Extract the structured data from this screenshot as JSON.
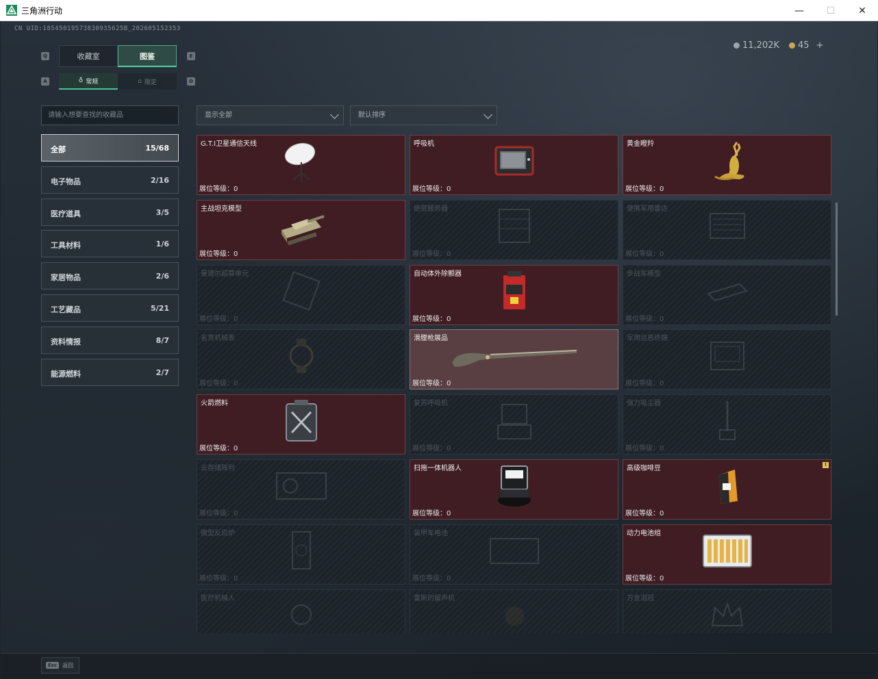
{
  "window": {
    "title": "三角洲行动",
    "minimize": "—",
    "maximize": "☐",
    "close": "✕"
  },
  "header": {
    "uid": "CN UID:18545019573838935625B_202605152353",
    "currency_1": "11,202K",
    "currency_2": "45",
    "add_label": "+"
  },
  "tabs": [
    {
      "label": "收藏室",
      "active": false
    },
    {
      "label": "图鉴",
      "active": true
    }
  ],
  "subtabs": [
    {
      "label": "常规",
      "active": true
    },
    {
      "label": "限定",
      "active": false
    }
  ],
  "key_hints": {
    "q": "Q",
    "e": "E",
    "a": "A",
    "d": "D"
  },
  "search": {
    "placeholder": "请输入想要查找的收藏品"
  },
  "filters": {
    "show": "显示全部",
    "sort": "默认排序"
  },
  "categories": [
    {
      "label": "全部",
      "count": "15/68",
      "active": true
    },
    {
      "label": "电子物品",
      "count": "2/16",
      "active": false
    },
    {
      "label": "医疗道具",
      "count": "3/5",
      "active": false
    },
    {
      "label": "工具材料",
      "count": "1/6",
      "active": false
    },
    {
      "label": "家居物品",
      "count": "2/6",
      "active": false
    },
    {
      "label": "工艺藏品",
      "count": "5/21",
      "active": false
    },
    {
      "label": "资料情报",
      "count": "8/7",
      "active": false
    },
    {
      "label": "能源燃料",
      "count": "2/7",
      "active": false
    }
  ],
  "level_label": "展位等级：0",
  "items": [
    {
      "name": "G.T.I卫星通信天线",
      "state": "owned",
      "icon": "satellite-dish-icon"
    },
    {
      "name": "呼吸机",
      "state": "owned",
      "icon": "ventilator-icon"
    },
    {
      "name": "黄金瞪羚",
      "state": "owned",
      "icon": "golden-gazelle-icon"
    },
    {
      "name": "主战坦克模型",
      "state": "owned",
      "icon": "tank-model-icon"
    },
    {
      "name": "绝密服务器",
      "state": "locked",
      "icon": "server-icon"
    },
    {
      "name": "便携军用雷达",
      "state": "locked",
      "icon": "radar-icon"
    },
    {
      "name": "曼德尔超算单元",
      "state": "locked",
      "icon": "supercomputer-icon"
    },
    {
      "name": "自动体外除颤器",
      "state": "owned",
      "icon": "defibrillator-icon"
    },
    {
      "name": "步战车模型",
      "state": "locked",
      "icon": "ifv-model-icon"
    },
    {
      "name": "名贵机械表",
      "state": "locked",
      "icon": "watch-icon"
    },
    {
      "name": "滑膛枪展品",
      "state": "selected",
      "icon": "musket-icon"
    },
    {
      "name": "军用信息终端",
      "state": "locked",
      "icon": "terminal-icon"
    },
    {
      "name": "火箭燃料",
      "state": "owned",
      "icon": "fuel-canister-icon"
    },
    {
      "name": "复苏呼吸机",
      "state": "locked",
      "icon": "respirator-icon"
    },
    {
      "name": "强力吸尘器",
      "state": "locked",
      "icon": "vacuum-icon"
    },
    {
      "name": "云存储阵列",
      "state": "locked",
      "icon": "storage-array-icon"
    },
    {
      "name": "扫拖一体机器人",
      "state": "owned",
      "icon": "robot-mop-icon"
    },
    {
      "name": "高级咖啡豆",
      "state": "owned",
      "icon": "coffee-beans-icon",
      "alert": "!"
    },
    {
      "name": "微型反应炉",
      "state": "locked",
      "icon": "reactor-icon"
    },
    {
      "name": "装甲车电池",
      "state": "locked",
      "icon": "vehicle-battery-icon"
    },
    {
      "name": "动力电池组",
      "state": "owned",
      "icon": "battery-pack-icon"
    },
    {
      "name": "医疗机械人",
      "state": "locked",
      "icon": "medical-robot-icon",
      "nolevel": true
    },
    {
      "name": "雷斯的留声机",
      "state": "locked",
      "icon": "phonograph-icon",
      "nolevel": true
    },
    {
      "name": "万金泪冠",
      "state": "locked",
      "icon": "crown-icon",
      "nolevel": true
    }
  ],
  "footer": {
    "esc_key": "Esc",
    "back_label": "返回"
  }
}
